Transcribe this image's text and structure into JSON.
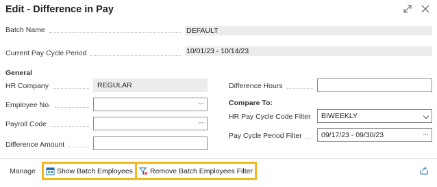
{
  "window": {
    "title": "Edit - Difference in Pay",
    "expand_icon": "expand-icon",
    "close_icon": "close-icon"
  },
  "header_fields": {
    "batch_name_label": "Batch Name",
    "batch_name_value": "DEFAULT",
    "pay_cycle_period_label": "Current Pay Cycle Period",
    "pay_cycle_period_value": "10/01/23 - 10/14/23"
  },
  "general": {
    "section_title": "General",
    "hr_company_label": "HR Company",
    "hr_company_value": "REGULAR",
    "employee_no_label": "Employee No.",
    "employee_no_value": "",
    "payroll_code_label": "Payroll Code",
    "payroll_code_value": "",
    "difference_amount_label": "Difference Amount",
    "difference_amount_value": "",
    "difference_hours_label": "Difference Hours",
    "difference_hours_value": ""
  },
  "compare_to": {
    "section_title": "Compare To:",
    "pay_cycle_code_filter_label": "HR Pay Cycle Code Filter",
    "pay_cycle_code_filter_value": "BIWEEKLY",
    "pay_cycle_period_filter_label": "Pay Cycle Period Filter",
    "pay_cycle_period_filter_value": "09/17/23 - 09/30/23"
  },
  "actions": {
    "manage_label": "Manage",
    "show_batch_employees_label": "Show Batch Employees",
    "remove_batch_filter_label": "Remove Batch Employees Filter",
    "highlight_color": "#f5b81c"
  }
}
